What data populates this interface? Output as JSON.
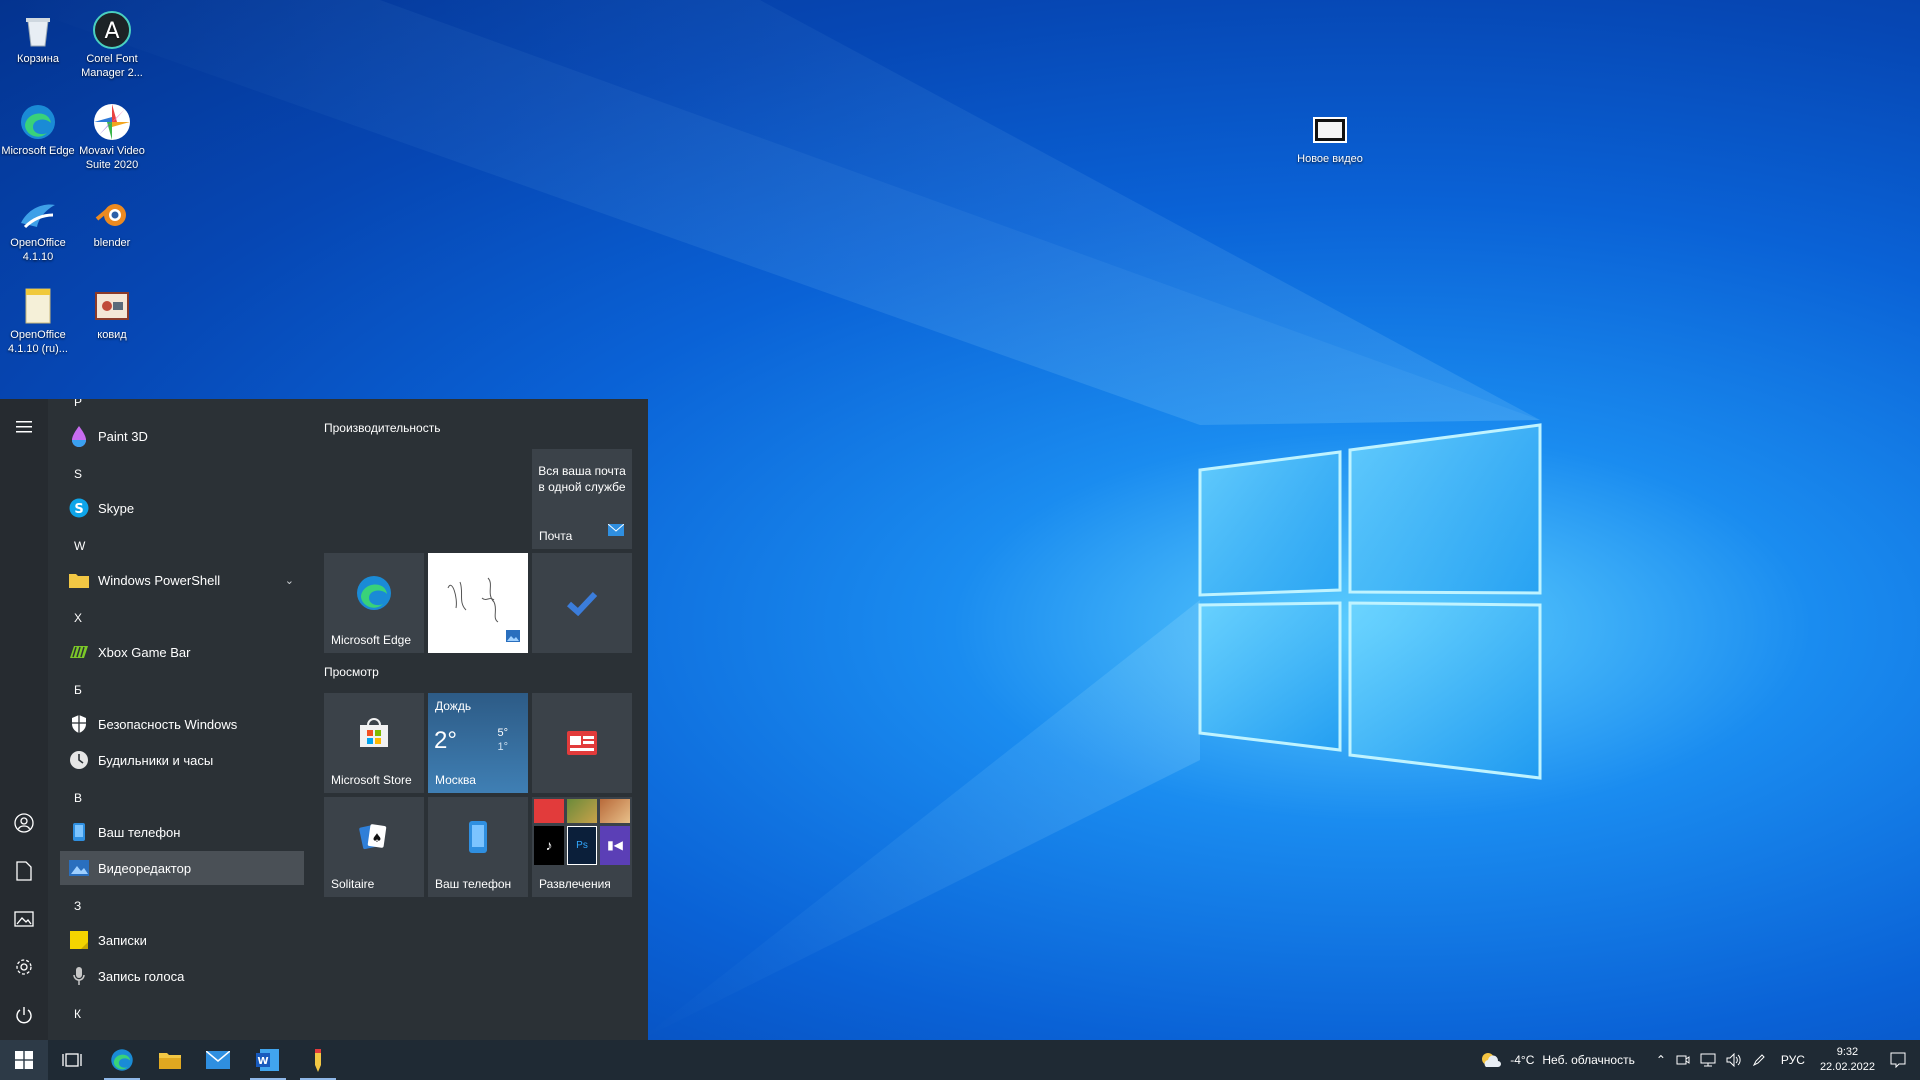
{
  "desktop": {
    "icons": [
      {
        "label": "Корзина"
      },
      {
        "label": "Corel Font Manager 2..."
      },
      {
        "label": "Microsoft Edge"
      },
      {
        "label": "Movavi Video Suite 2020"
      },
      {
        "label": "OpenOffice 4.1.10"
      },
      {
        "label": "blender"
      },
      {
        "label": "OpenOffice 4.1.10 (ru)..."
      },
      {
        "label": "ковид"
      },
      {
        "label": "Новое видео"
      }
    ]
  },
  "start_menu": {
    "letters": [
      "P",
      "S",
      "W",
      "X",
      "Б",
      "В",
      "З",
      "К"
    ],
    "apps": [
      {
        "label": "Paint 3D"
      },
      {
        "label": "Skype"
      },
      {
        "label": "Windows PowerShell"
      },
      {
        "label": "Xbox Game Bar"
      },
      {
        "label": "Безопасность Windows"
      },
      {
        "label": "Будильники и часы"
      },
      {
        "label": "Ваш телефон"
      },
      {
        "label": "Видеоредактор"
      },
      {
        "label": "Записки"
      },
      {
        "label": "Запись голоса"
      }
    ],
    "groups": {
      "productivity": "Производительность",
      "view": "Просмотр"
    },
    "tiles": {
      "mail_text": "Вся ваша почта в одной службе",
      "mail_label": "Почта",
      "edge_label": "Microsoft Edge",
      "store_label": "Microsoft Store",
      "weather_cond": "Дождь",
      "weather_temp": "2°",
      "weather_high": "5°",
      "weather_low": "1°",
      "weather_city": "Москва",
      "solitaire_label": "Solitaire",
      "phone_label": "Ваш телефон",
      "entertainment_label": "Развлечения"
    }
  },
  "taskbar": {
    "weather_temp": "-4°C",
    "weather_text": "Неб. облачность",
    "language": "РУС",
    "time": "9:32",
    "date": "22.02.2022"
  }
}
